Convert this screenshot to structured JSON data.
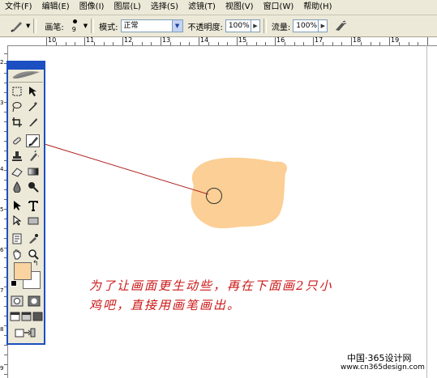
{
  "menu": [
    "文件(F)",
    "编辑(E)",
    "图像(I)",
    "图层(L)",
    "选择(S)",
    "滤镜(T)",
    "视图(V)",
    "窗口(W)",
    "帮助(H)"
  ],
  "options": {
    "brush_label": "画笔:",
    "brush_size": "9",
    "mode_label": "模式:",
    "mode_value": "正常",
    "opacity_label": "不透明度:",
    "opacity_value": "100%",
    "flow_label": "流量:",
    "flow_value": "100%"
  },
  "ruler": {
    "top_labels": [
      "10",
      "11",
      "12",
      "13",
      "14",
      "15",
      "16",
      "17",
      "18",
      "19"
    ],
    "left_labels": [
      "2",
      "3",
      "4",
      "5",
      "6",
      "7",
      "8",
      "9"
    ]
  },
  "colors": {
    "foreground": "#f9d3a0",
    "background": "#ffffff",
    "blob": "#fbcf95",
    "annotation": "#cc1818",
    "toolbox_border": "#1c4fc1"
  },
  "annotation": {
    "line1": "为了让画面更生动些，再在下面画2只小",
    "line2": "鸡吧，直接用画笔画出。"
  },
  "watermark": {
    "line1": "中国·365设计网",
    "line2": "www.cn365design.com"
  }
}
